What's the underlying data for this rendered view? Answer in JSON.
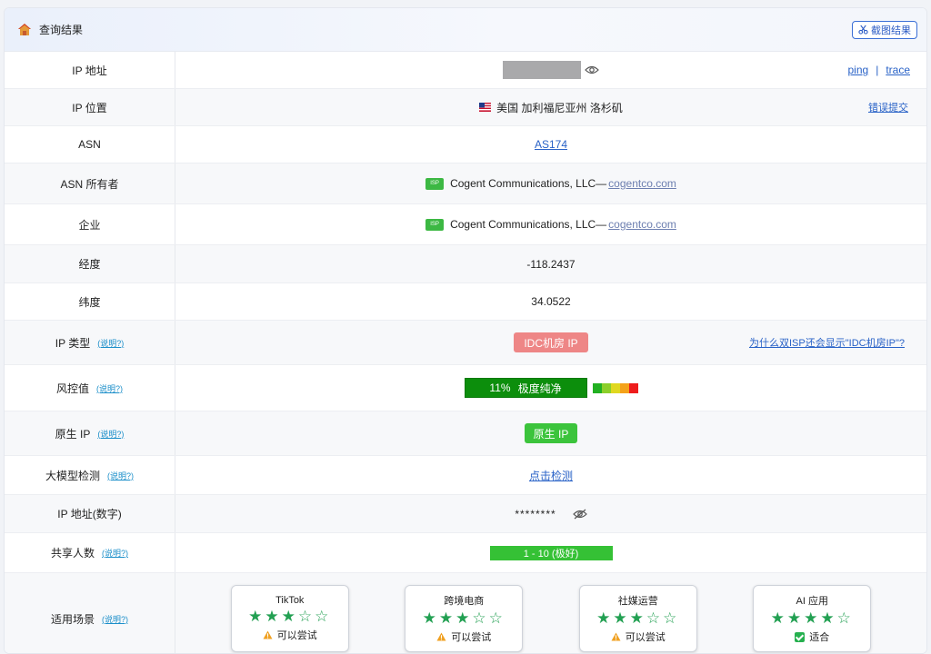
{
  "header": {
    "title": "查询结果",
    "screenshot_label": "截图结果"
  },
  "help_label": "(说明?)",
  "rows": {
    "ip_address": {
      "label": "IP 地址",
      "ping": "ping",
      "sep": "|",
      "trace": "trace"
    },
    "ip_location": {
      "label": "IP 位置",
      "value": "美国 加利福尼亚州 洛杉矶",
      "report": "错误提交"
    },
    "asn": {
      "label": "ASN",
      "value": "AS174"
    },
    "asn_owner": {
      "label": "ASN 所有者",
      "badge": "ISP",
      "name": "Cogent Communications, LLC—",
      "domain": "cogentco.com"
    },
    "company": {
      "label": "企业",
      "badge": "ISP",
      "name": "Cogent Communications, LLC—",
      "domain": "cogentco.com"
    },
    "longitude": {
      "label": "经度",
      "value": "-118.2437"
    },
    "latitude": {
      "label": "纬度",
      "value": "34.0522"
    },
    "ip_type": {
      "label": "IP 类型",
      "value": "IDC机房 IP",
      "question": "为什么双ISP还会显示\"IDC机房IP\"?"
    },
    "risk": {
      "label": "风控值",
      "percent": "11%",
      "text": "极度纯净",
      "scale_colors": [
        "#22b022",
        "#8ccf2a",
        "#e0d81f",
        "#f4a21a",
        "#ee1c1c"
      ]
    },
    "native_ip": {
      "label": "原生 IP",
      "value": "原生 IP"
    },
    "ai_detect": {
      "label": "大模型检测",
      "value": "点击检测"
    },
    "ip_numeric": {
      "label": "IP 地址(数字)",
      "value": "********"
    },
    "shared_users": {
      "label": "共享人数",
      "value": "1 - 10 (极好)"
    },
    "scenes": {
      "label": "适用场景",
      "cards": [
        {
          "title": "TikTok",
          "stars": "★★★☆☆",
          "rating": 3,
          "status": "可以尝试",
          "status_icon": "warning-icon"
        },
        {
          "title": "跨境电商",
          "stars": "★★★☆☆",
          "rating": 3,
          "status": "可以尝试",
          "status_icon": "warning-icon"
        },
        {
          "title": "社媒运营",
          "stars": "★★★☆☆",
          "rating": 3,
          "status": "可以尝试",
          "status_icon": "warning-icon"
        },
        {
          "title": "AI 应用",
          "stars": "★★★★☆",
          "rating": 4,
          "status": "适合",
          "status_icon": "check-icon"
        }
      ]
    }
  },
  "colors": {
    "accent": "#2962c7",
    "isp_green": "#3cb843",
    "idc_red": "#ee8686",
    "risk_green": "#0c8e0c",
    "star_green": "#22a052"
  }
}
